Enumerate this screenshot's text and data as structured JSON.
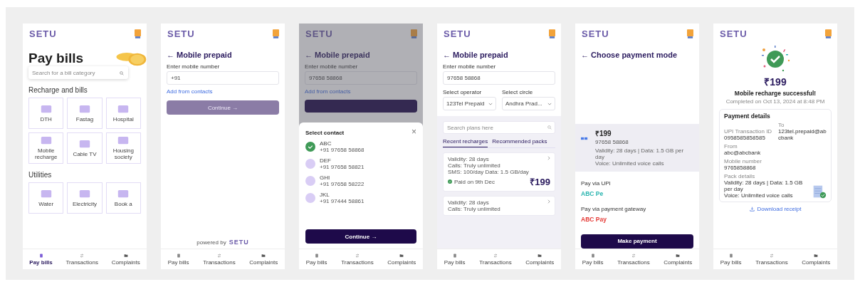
{
  "screens": [
    {
      "kind": "home",
      "logo": "SETU",
      "title": "Pay bills",
      "search_placeholder": "Search for a bill category",
      "sections": [
        {
          "title": "Recharge and bills",
          "tiles": [
            "DTH",
            "Fastag",
            "Hospital",
            "Mobile recharge",
            "Cable TV",
            "Housing society"
          ]
        },
        {
          "title": "Utilities",
          "tiles": [
            "Water",
            "Electricity",
            "Book a"
          ]
        }
      ],
      "nav": [
        {
          "label": "Pay bills",
          "selected": true
        },
        {
          "label": "Transactions",
          "selected": false
        },
        {
          "label": "Complaints",
          "selected": false
        }
      ]
    },
    {
      "kind": "prepaid",
      "logo": "SETU",
      "back": "←",
      "title": "Mobile prepaid",
      "field_label": "Enter mobile number",
      "field_value": "+91",
      "link": "Add from contacts",
      "button": {
        "label": "Continue →",
        "disabled": true
      },
      "footer": "powered by",
      "footer_logo": "SETU",
      "nav": [
        {
          "label": "Pay bills",
          "selected": false
        },
        {
          "label": "Transactions",
          "selected": false
        },
        {
          "label": "Complaints",
          "selected": false
        }
      ]
    },
    {
      "kind": "contacts",
      "logo": "SETU",
      "back": "←",
      "title": "Mobile prepaid",
      "field_label": "Enter mobile number",
      "field_value": "97658 58868",
      "link": "Add from contacts",
      "close": "×",
      "sheet_title": "Select contact",
      "contacts": [
        {
          "name": "ABC",
          "phone": "+91 97658 58868",
          "selected": true
        },
        {
          "name": "DEF",
          "phone": "+91 97658 58821",
          "selected": false
        },
        {
          "name": "GHI",
          "phone": "+91 97658 58222",
          "selected": false
        },
        {
          "name": "JKL",
          "phone": "+91 97444 58861",
          "selected": false
        }
      ],
      "button": "Continue →",
      "nav": [
        {
          "label": "Pay bills",
          "selected": false
        },
        {
          "label": "Transactions",
          "selected": false
        },
        {
          "label": "Complaints",
          "selected": false
        }
      ]
    },
    {
      "kind": "plans",
      "logo": "SETU",
      "back": "←",
      "title": "Mobile prepaid",
      "field_label": "Enter mobile number",
      "field_value": "97658 58868",
      "selects": [
        {
          "label": "Select operator",
          "value": "123Tel Prepaid"
        },
        {
          "label": "Select circle",
          "value": "Andhra Prad..."
        }
      ],
      "search_placeholder": "Search plans here",
      "tabs": [
        {
          "label": "Recent recharges",
          "selected": true
        },
        {
          "label": "Recommended packs",
          "selected": false
        }
      ],
      "plans": [
        {
          "lines": [
            "Validity: 28 days",
            "Calls: Truly unlimited",
            "SMS: 100/day Data: 1.5 GB/day"
          ],
          "status": "Paid on 9th Dec",
          "price": "₹199"
        },
        {
          "lines": [
            "Validity: 28 days",
            "Calls: Truly unlimited"
          ]
        }
      ],
      "nav": [
        {
          "label": "Pay bills",
          "selected": false
        },
        {
          "label": "Transactions",
          "selected": false
        },
        {
          "label": "Complaints",
          "selected": false
        }
      ]
    },
    {
      "kind": "payment",
      "logo": "SETU",
      "back": "←",
      "title": "Choose payment mode",
      "summary": {
        "amount": "₹199",
        "number": "97658 58868",
        "details": [
          "Validity: 28 days | Data: 1.5 GB per day",
          "Voice: Unlimited voice calls"
        ]
      },
      "groups": [
        {
          "title": "Pay via UPI",
          "option": "ABC Pe",
          "color": "#2bb5b0"
        },
        {
          "title": "Pay via payment gateway",
          "option": "ABC Pay",
          "color": "#e53935"
        }
      ],
      "button": "Make payment",
      "nav": [
        {
          "label": "Pay bills",
          "selected": false
        },
        {
          "label": "Transactions",
          "selected": false
        },
        {
          "label": "Complaints",
          "selected": false
        }
      ]
    },
    {
      "kind": "success",
      "logo": "SETU",
      "amount": "₹199",
      "message": "Mobile recharge successful!",
      "completed": "Completed on Oct 13, 2024 at 8:48 PM",
      "card_title": "Payment details",
      "rows": [
        [
          {
            "label": "UPI Transaction ID",
            "values": [
              "0958585858585"
            ]
          },
          {
            "label": "To",
            "values": [
              "123tel.prepaid@abcbank"
            ]
          }
        ],
        [
          {
            "label": "From",
            "values": [
              "abc@abcbank"
            ]
          }
        ],
        [
          {
            "label": "Mobile number",
            "values": [
              "9765858868"
            ]
          }
        ],
        [
          {
            "label": "Pack details",
            "values": [
              "Validity: 28 days | Data: 1.5 GB per day",
              "Voice: Unlimited voice calls"
            ]
          }
        ]
      ],
      "download": "Download receipt",
      "nav": [
        {
          "label": "Pay bills",
          "selected": false
        },
        {
          "label": "Transactions",
          "selected": false
        },
        {
          "label": "Complaints",
          "selected": false
        }
      ]
    }
  ]
}
